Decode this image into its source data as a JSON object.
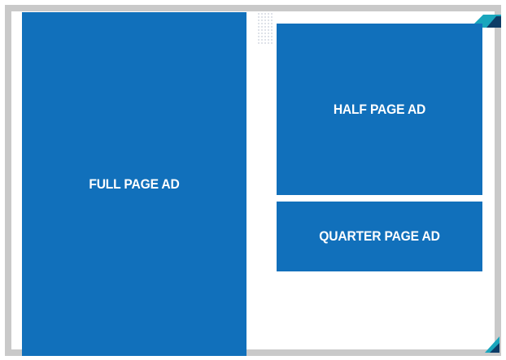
{
  "ads": {
    "full_page": "FULL PAGE AD",
    "half_page": "HALF PAGE AD",
    "quarter_page": "QUARTER PAGE AD"
  },
  "colors": {
    "ad_blue": "#1170bb",
    "frame_gray": "#c9c9c9",
    "accent_teal": "#19a6bd",
    "accent_navy": "#0d3c66"
  }
}
